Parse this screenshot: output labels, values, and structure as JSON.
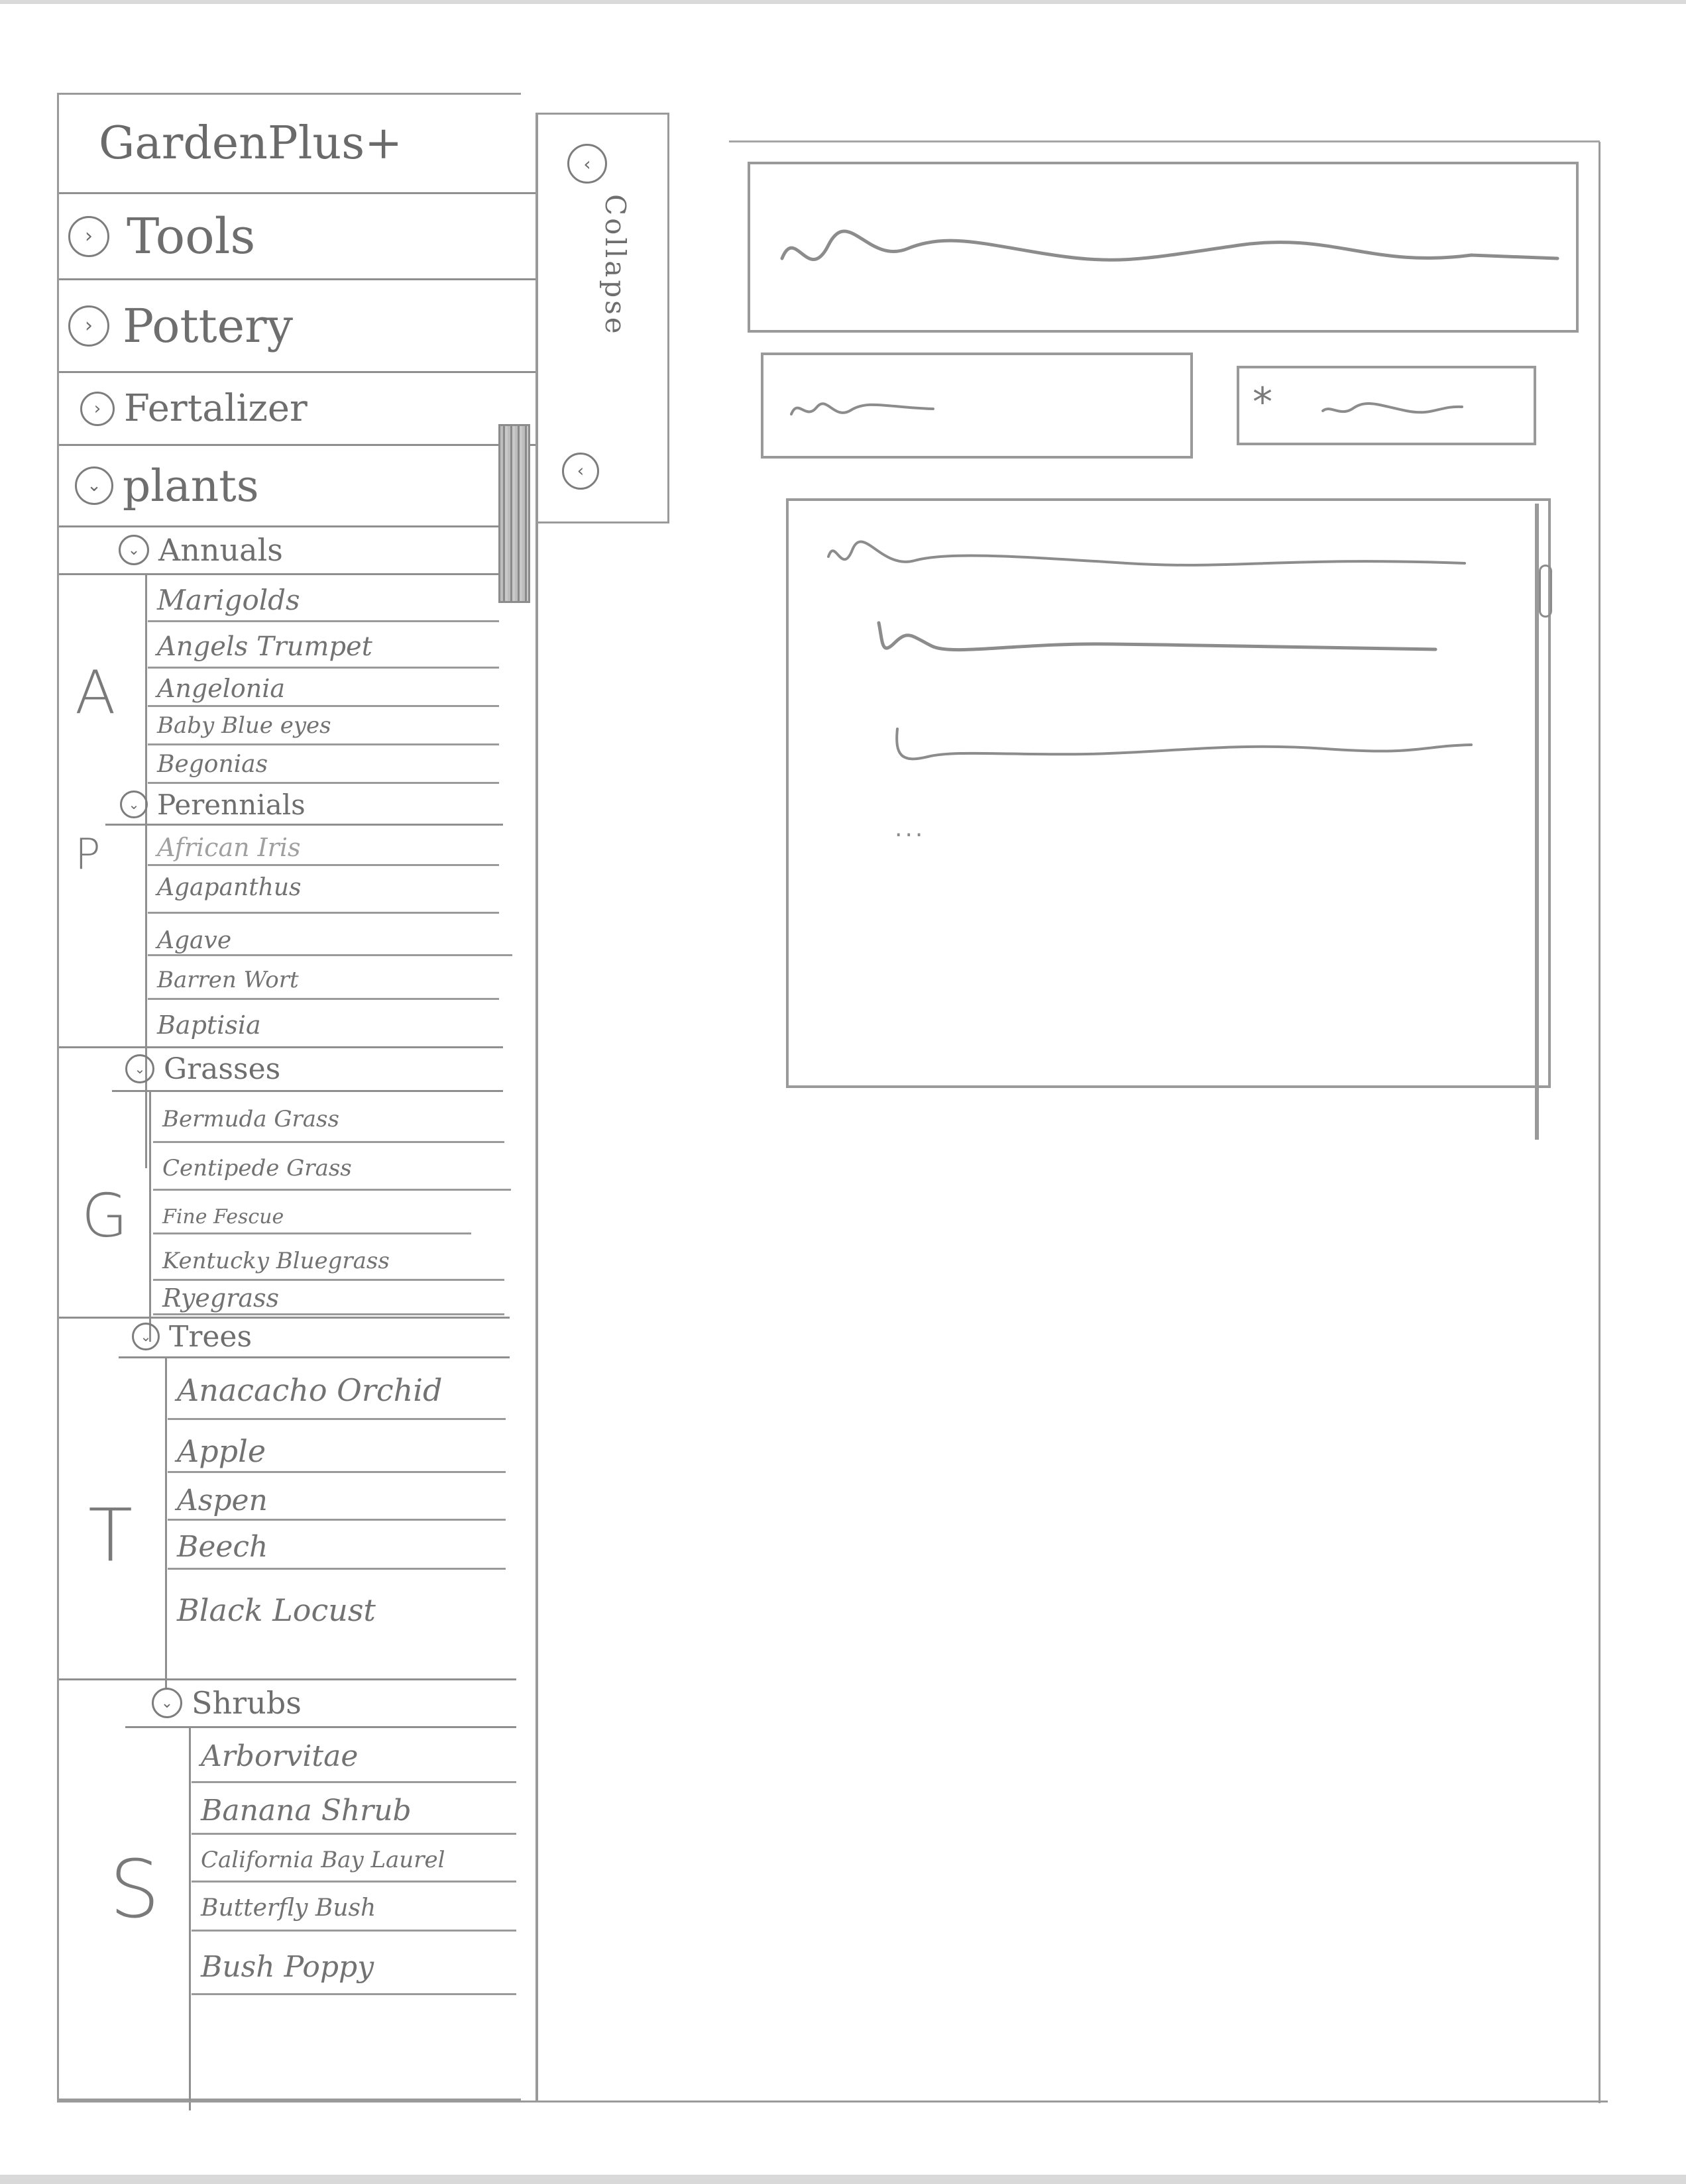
{
  "app": {
    "title": "GardenPlus+"
  },
  "collapse": {
    "label": "Collapse"
  },
  "nav": {
    "categories": [
      {
        "label": "Tools",
        "icon": "chevron-right-icon"
      },
      {
        "label": "Pottery",
        "icon": "chevron-right-icon"
      },
      {
        "label": "Fertalizer",
        "icon": "chevron-right-icon"
      },
      {
        "label": "plants",
        "icon": "chevron-down-icon"
      }
    ],
    "plant_groups": [
      {
        "letter": "A",
        "label": "Annuals",
        "items": [
          "Marigolds",
          "Angels Trumpet",
          "Angelonia",
          "Baby Blue eyes",
          "Begonias"
        ]
      },
      {
        "letter": "P",
        "label": "Perennials",
        "items": [
          "African Iris",
          "Agapanthus",
          "Agave",
          "Barren Wort",
          "Baptisia"
        ]
      },
      {
        "letter": "G",
        "label": "Grasses",
        "items": [
          "Bermuda Grass",
          "Centipede Grass",
          "Fine Fescue",
          "Kentucky Bluegrass",
          "Ryegrass"
        ]
      },
      {
        "letter": "T",
        "label": "Trees",
        "items": [
          "Anacacho Orchid",
          "Apple",
          "Aspen",
          "Beech",
          "Black Locust"
        ]
      },
      {
        "letter": "S",
        "label": "Shrubs",
        "items": [
          "Arborvitae",
          "Banana Shrub",
          "California Bay Laurel",
          "Butterfly Bush",
          "Bush Poppy"
        ]
      }
    ]
  },
  "content": {
    "tool_button_icon": "asterisk-icon",
    "list_more": "..."
  },
  "colors": {
    "pencil": "#8c8c8c",
    "paper": "#ffffff"
  }
}
